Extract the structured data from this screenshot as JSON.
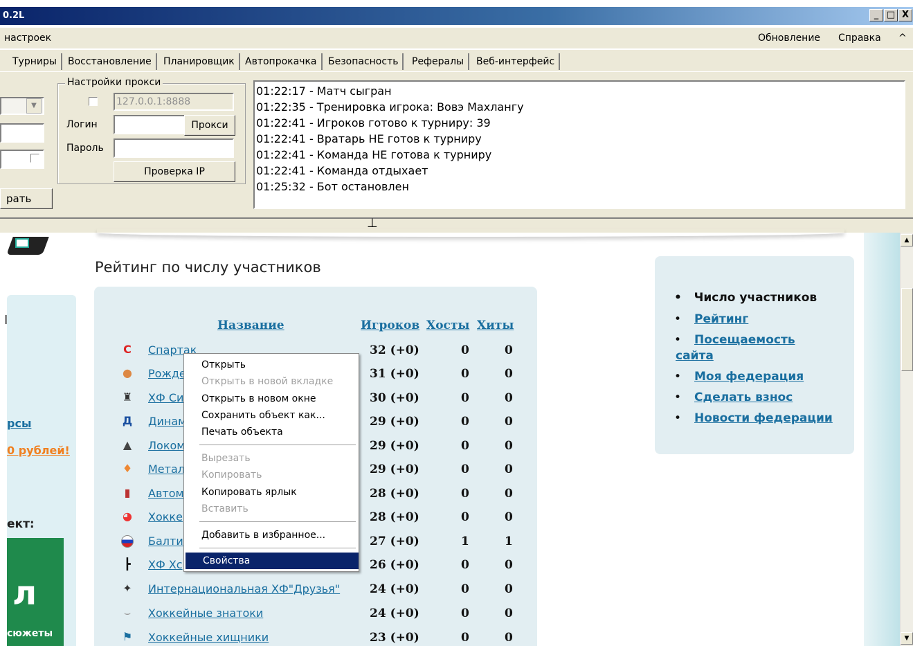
{
  "window": {
    "title": "0.2L",
    "btn_min": "_",
    "btn_max": "□",
    "btn_close": "X"
  },
  "menu": {
    "left": "настроек",
    "update": "Обновление",
    "help": "Справка",
    "caret": "^"
  },
  "tabs": [
    "Турниры",
    "Восстановление",
    "Планировщик",
    "Автопрокачка",
    "Безопасность",
    "Рефералы",
    "Веб-интерфейс"
  ],
  "proxy": {
    "group_title": "Настройки прокси",
    "address": "127.0.0.1:8888",
    "login_label": "Логин",
    "password_label": "Пароль",
    "proxy_button": "Прокси",
    "check_ip_button": "Проверка IP"
  },
  "left_panel": {
    "button_partial": "рать"
  },
  "log": [
    "01:22:17 - Матч сыгран",
    "01:22:35 - Тренировка игрока: Вовэ Махлангу",
    "01:22:41 - Игроков готово к турниру: 39",
    "01:22:41 - Вратарь НЕ готов к турниру",
    "01:22:41 - Команда НЕ готова к турниру",
    "01:22:41 - Команда отдыхает",
    "01:25:32 - Бот остановлен"
  ],
  "web": {
    "heading": "Рейтинг по числу участников",
    "columns": {
      "name": "Название",
      "players": "Игроков",
      "hosts": "Хосты",
      "hits": "Хиты"
    },
    "rows": [
      {
        "name": "Спартак",
        "players": "32 (+0)",
        "hosts": "0",
        "hits": "0",
        "icon": "spartak-logo-icon"
      },
      {
        "name": "Рожде",
        "players": "31 (+0)",
        "hosts": "0",
        "hits": "0",
        "icon": "emblem-icon"
      },
      {
        "name": "ХФ Си",
        "players": "30 (+0)",
        "hosts": "0",
        "hits": "0",
        "icon": "castle-icon"
      },
      {
        "name": "Динам",
        "players": "29 (+0)",
        "hosts": "0",
        "hits": "0",
        "icon": "dynamo-logo-icon"
      },
      {
        "name": "Локом",
        "players": "29 (+0)",
        "hosts": "0",
        "hits": "0",
        "icon": "locomotive-icon"
      },
      {
        "name": "Метал",
        "players": "29 (+0)",
        "hosts": "0",
        "hits": "0",
        "icon": "flame-icon"
      },
      {
        "name": "Автом",
        "players": "28 (+0)",
        "hosts": "0",
        "hits": "0",
        "icon": "shield-icon"
      },
      {
        "name": "Хокке",
        "players": "28 (+0)",
        "hosts": "0",
        "hits": "0",
        "icon": "ball-icon"
      },
      {
        "name": "Балти",
        "players": "27 (+0)",
        "hosts": "1",
        "hits": "1",
        "icon": "russia-ball-icon"
      },
      {
        "name": "ХФ Хс",
        "players": "26 (+0)",
        "hosts": "0",
        "hits": "0",
        "icon": "stick-icon"
      },
      {
        "name": "Интернациональная ХФ\"Друзья\"",
        "players": "24 (+0)",
        "hosts": "0",
        "hits": "0",
        "icon": "players-icon"
      },
      {
        "name": "Хоккейные знатоки",
        "players": "24 (+0)",
        "hosts": "0",
        "hits": "0",
        "icon": "wings-icon"
      },
      {
        "name": "Хоккейные хищники",
        "players": "23 (+0)",
        "hosts": "0",
        "hits": "0",
        "icon": "flag-icon"
      }
    ],
    "left_fragments": {
      "a": "рсы",
      "b": "0 рублей!",
      "c": "ект:",
      "d": "л",
      "e": "сюжеты",
      "f": "I"
    },
    "right_menu": {
      "current": "Число участников",
      "links": [
        "Рейтинг",
        "Посещаемость сайта",
        "Моя федерация",
        "Сделать взнос",
        "Новости федерации"
      ]
    }
  },
  "context_menu": {
    "items": [
      {
        "label": "Открыть",
        "state": "normal"
      },
      {
        "label": "Открыть в новой вкладке",
        "state": "disabled"
      },
      {
        "label": "Открыть в новом окне",
        "state": "normal"
      },
      {
        "label": "Сохранить объект как...",
        "state": "normal"
      },
      {
        "label": "Печать объекта",
        "state": "normal"
      },
      {
        "label": "Вырезать",
        "state": "disabled"
      },
      {
        "label": "Копировать",
        "state": "disabled"
      },
      {
        "label": "Копировать ярлык",
        "state": "normal"
      },
      {
        "label": "Вставить",
        "state": "disabled"
      },
      {
        "label": "Добавить в избранное...",
        "state": "normal"
      },
      {
        "label": "Свойства",
        "state": "selected"
      }
    ]
  }
}
